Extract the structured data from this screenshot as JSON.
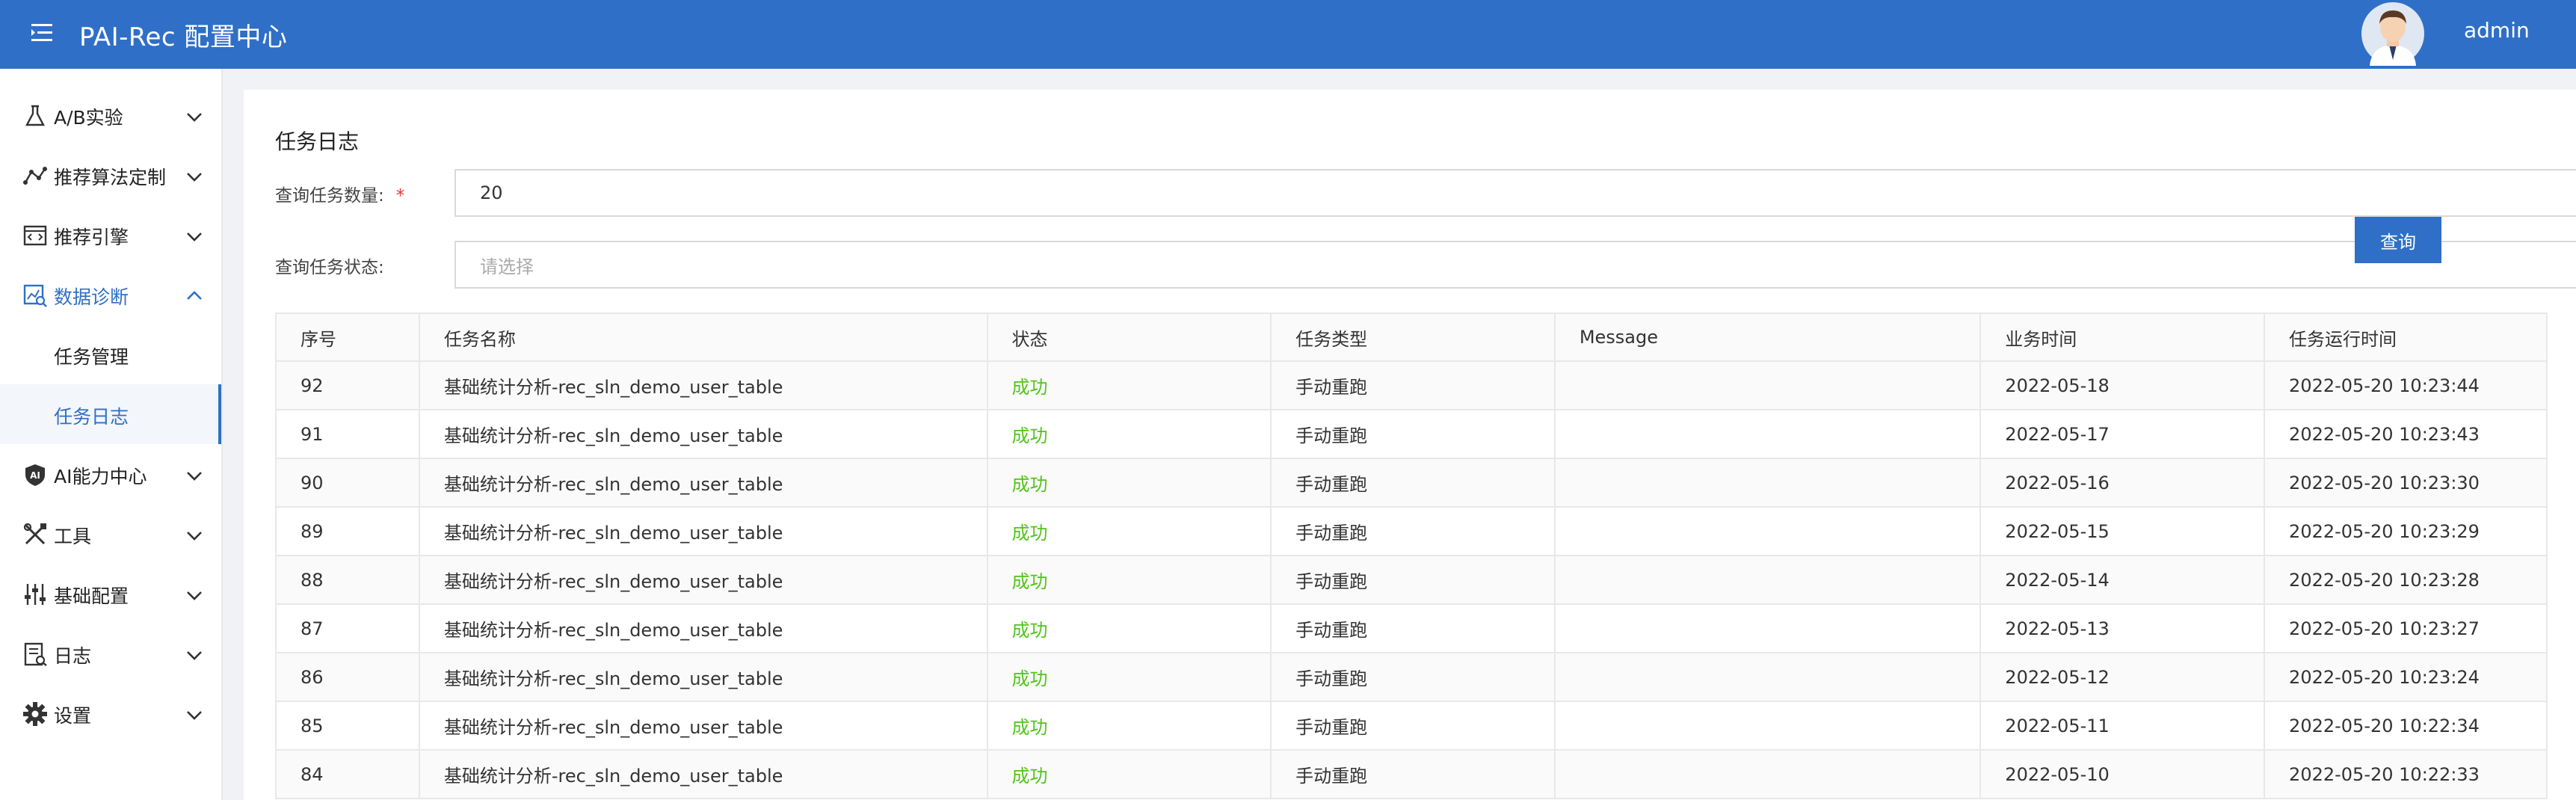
{
  "header": {
    "title": "PAI-Rec 配置中心",
    "user": "admin"
  },
  "sidebar": {
    "items": [
      {
        "label": "A/B实验",
        "icon": "flask-icon"
      },
      {
        "label": "推荐算法定制",
        "icon": "graph-nodes-icon"
      },
      {
        "label": "推荐引擎",
        "icon": "code-window-icon"
      },
      {
        "label": "数据诊断",
        "icon": "chart-search-icon",
        "expanded": true
      },
      {
        "label": "AI能力中心",
        "icon": "ai-shield-icon"
      },
      {
        "label": "工具",
        "icon": "tools-icon"
      },
      {
        "label": "基础配置",
        "icon": "sliders-icon"
      },
      {
        "label": "日志",
        "icon": "log-document-icon"
      },
      {
        "label": "设置",
        "icon": "gear-icon"
      }
    ],
    "sub_items": [
      {
        "label": "任务管理",
        "active": false
      },
      {
        "label": "任务日志",
        "active": true
      }
    ]
  },
  "main": {
    "title": "任务日志",
    "form": {
      "count_label": "查询任务数量:",
      "required_mark": "*",
      "count_value": "20",
      "status_label": "查询任务状态:",
      "status_placeholder": "请选择",
      "query_button": "查询"
    },
    "table": {
      "headers": [
        "序号",
        "任务名称",
        "状态",
        "任务类型",
        "Message",
        "业务时间",
        "任务运行时间"
      ],
      "rows": [
        [
          "92",
          "基础统计分析-rec_sln_demo_user_table",
          "成功",
          "手动重跑",
          "",
          "2022-05-18",
          "2022-05-20 10:23:44"
        ],
        [
          "91",
          "基础统计分析-rec_sln_demo_user_table",
          "成功",
          "手动重跑",
          "",
          "2022-05-17",
          "2022-05-20 10:23:43"
        ],
        [
          "90",
          "基础统计分析-rec_sln_demo_user_table",
          "成功",
          "手动重跑",
          "",
          "2022-05-16",
          "2022-05-20 10:23:30"
        ],
        [
          "89",
          "基础统计分析-rec_sln_demo_user_table",
          "成功",
          "手动重跑",
          "",
          "2022-05-15",
          "2022-05-20 10:23:29"
        ],
        [
          "88",
          "基础统计分析-rec_sln_demo_user_table",
          "成功",
          "手动重跑",
          "",
          "2022-05-14",
          "2022-05-20 10:23:28"
        ],
        [
          "87",
          "基础统计分析-rec_sln_demo_user_table",
          "成功",
          "手动重跑",
          "",
          "2022-05-13",
          "2022-05-20 10:23:27"
        ],
        [
          "86",
          "基础统计分析-rec_sln_demo_user_table",
          "成功",
          "手动重跑",
          "",
          "2022-05-12",
          "2022-05-20 10:23:24"
        ],
        [
          "85",
          "基础统计分析-rec_sln_demo_user_table",
          "成功",
          "手动重跑",
          "",
          "2022-05-11",
          "2022-05-20 10:22:34"
        ],
        [
          "84",
          "基础统计分析-rec_sln_demo_user_table",
          "成功",
          "手动重跑",
          "",
          "2022-05-10",
          "2022-05-20 10:22:33"
        ]
      ]
    }
  },
  "colors": {
    "primary": "#2f6fc7",
    "success": "#52c41a",
    "required": "#ee3333"
  }
}
